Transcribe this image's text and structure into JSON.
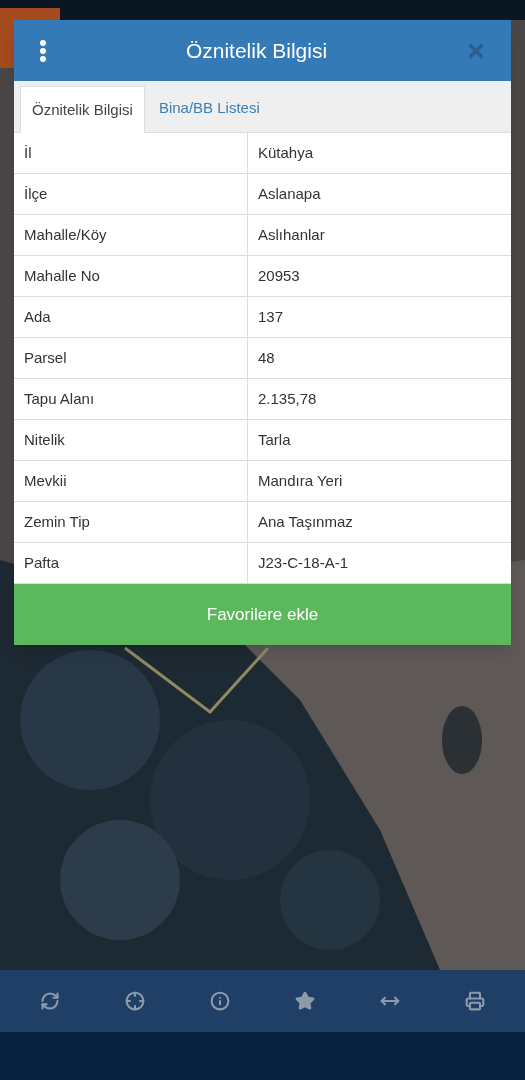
{
  "dialog": {
    "title": "Öznitelik Bilgisi"
  },
  "tabs": [
    {
      "label": "Öznitelik Bilgisi",
      "selected": true
    },
    {
      "label": "Bina/BB Listesi",
      "selected": false
    }
  ],
  "attributes": [
    {
      "name": "İl",
      "value": "Kütahya"
    },
    {
      "name": "İlçe",
      "value": "Aslanapa"
    },
    {
      "name": "Mahalle/Köy",
      "value": "Aslıhanlar"
    },
    {
      "name": "Mahalle No",
      "value": "20953"
    },
    {
      "name": "Ada",
      "value": "137"
    },
    {
      "name": "Parsel",
      "value": "48"
    },
    {
      "name": "Tapu Alanı",
      "value": "2.135,78"
    },
    {
      "name": "Nitelik",
      "value": "Tarla"
    },
    {
      "name": "Mevkii",
      "value": "Mandıra Yeri"
    },
    {
      "name": "Zemin Tip",
      "value": "Ana Taşınmaz"
    },
    {
      "name": "Pafta",
      "value": "J23-C-18-A-1"
    }
  ],
  "action_button": "Favorilere ekle",
  "toolbar": [
    {
      "kind": "refresh"
    },
    {
      "kind": "locate"
    },
    {
      "kind": "info"
    },
    {
      "kind": "favorite"
    },
    {
      "kind": "measure"
    },
    {
      "kind": "print"
    }
  ]
}
